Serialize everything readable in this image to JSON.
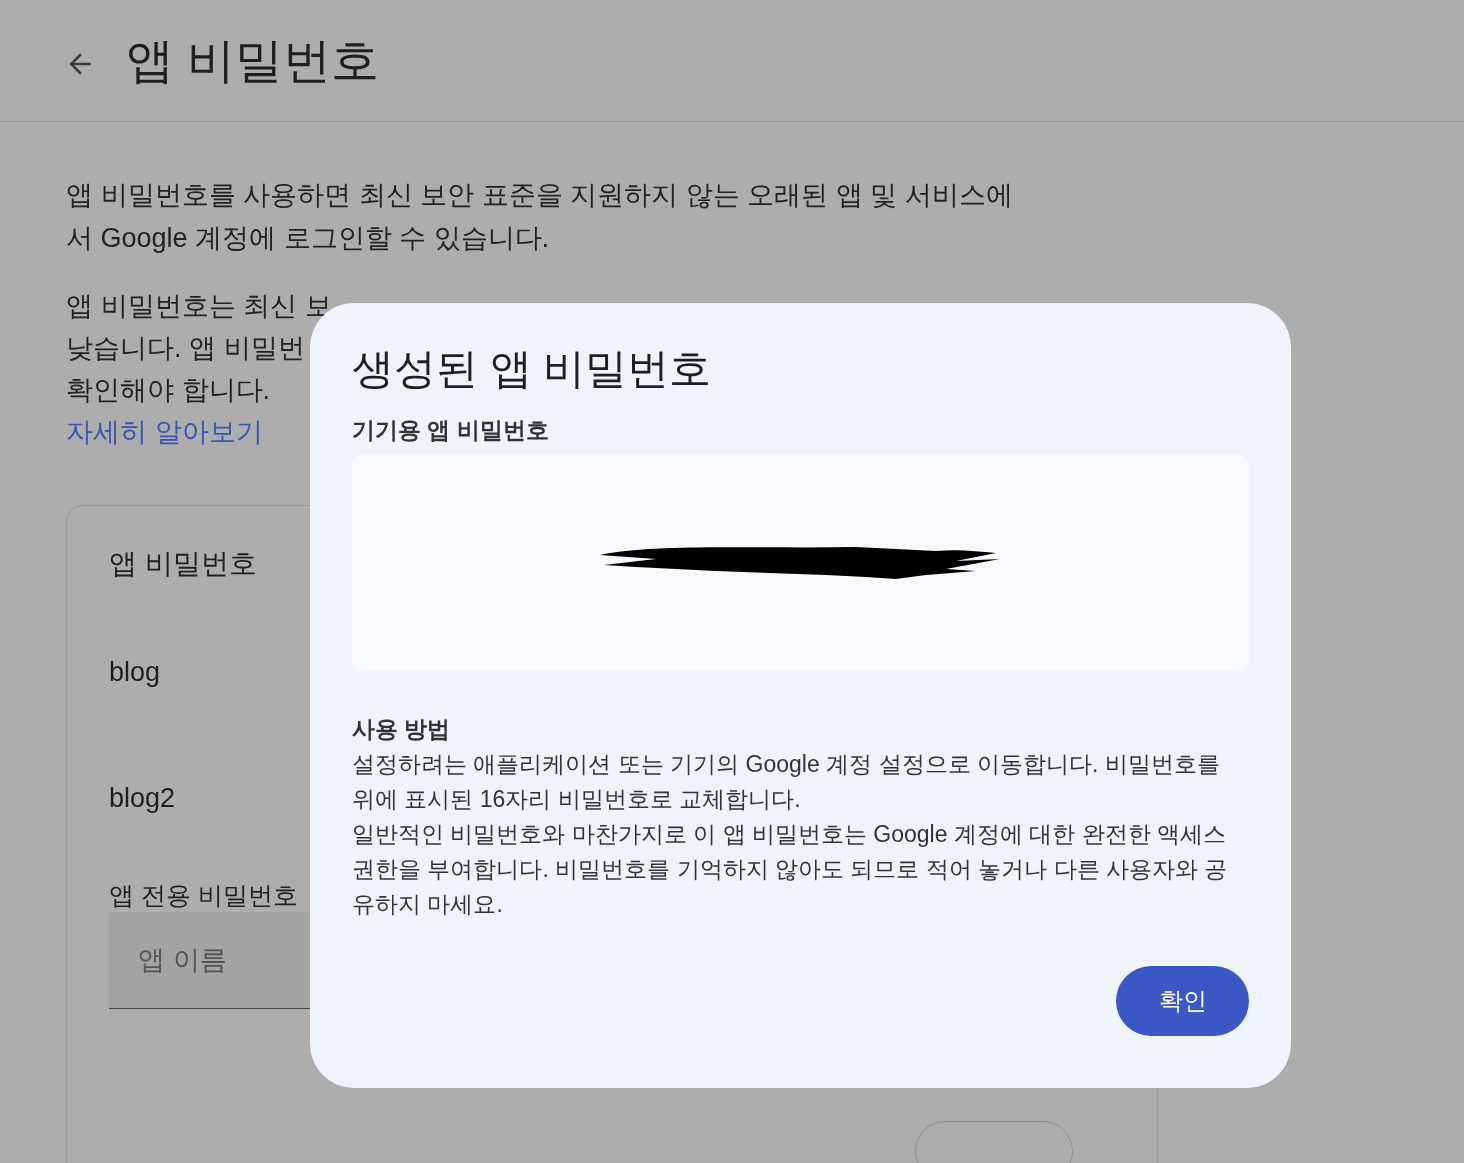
{
  "header": {
    "title": "앱 비밀번호"
  },
  "intro": "앱 비밀번호를 사용하면 최신 보안 표준을 지원하지 않는 오래된 앱 및 서비스에서 Google 계정에 로그인할 수 있습니다.",
  "notice_lines": [
    "앱 비밀번호는 최신 보",
    "낮습니다. 앱 비밀번",
    "확인해야 합니다."
  ],
  "learn_more_link": "자세히 알아보기",
  "card": {
    "title": "앱 비밀번호",
    "apps": [
      "blog",
      "blog2"
    ],
    "create_label": "앱 전용 비밀번호",
    "name_field": {
      "placeholder": "앱 이름"
    }
  },
  "dialog": {
    "title": "생성된 앱 비밀번호",
    "password_label": "기기용 앱 비밀번호",
    "howto_title": "사용 방법",
    "howto_paragraphs": [
      "설정하려는 애플리케이션 또는 기기의 Google 계정 설정으로 이동합니다. 비밀번호를 위에 표시된 16자리 비밀번호로 교체합니다.",
      "일반적인 비밀번호와 마찬가지로 이 앱 비밀번호는 Google 계정에 대한 완전한 액세스 권한을 부여합니다. 비밀번호를 기억하지 않아도 되므로 적어 놓거나 다른 사용자와 공유하지 마세요."
    ],
    "confirm_button": "확인"
  }
}
